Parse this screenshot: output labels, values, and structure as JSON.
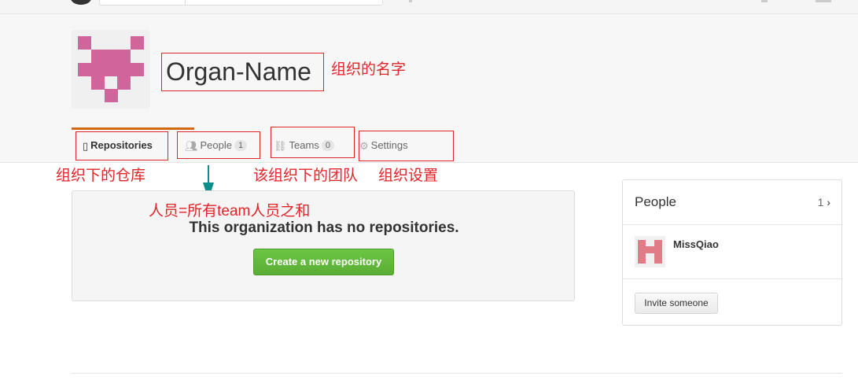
{
  "org": {
    "name": "Organ-Name"
  },
  "tabs": [
    {
      "label": "Repositories",
      "icon": "repo-icon",
      "count": null
    },
    {
      "label": "People",
      "icon": "people-icon",
      "count": "1"
    },
    {
      "label": "Teams",
      "icon": "team-icon",
      "count": "0"
    },
    {
      "label": "Settings",
      "icon": "gear-icon",
      "count": null
    }
  ],
  "annotations": {
    "org_name": "组织的名字",
    "repos": "组织下的仓库",
    "teams": "该组织下的团队",
    "settings": "组织设置",
    "people": "人员=所有team人员之和"
  },
  "repos": {
    "empty_message": "This organization has no repositories.",
    "create_button": "Create a new repository"
  },
  "people_panel": {
    "title": "People",
    "count": "1",
    "members": [
      {
        "name": "MissQiao"
      }
    ],
    "invite_button": "Invite someone"
  },
  "colors": {
    "annotation_red": "#e0252a",
    "tab_accent": "#d26911",
    "button_green": "#6cc644",
    "arrow_teal": "#0a8f8a",
    "avatar_pink": "#d0659b"
  }
}
